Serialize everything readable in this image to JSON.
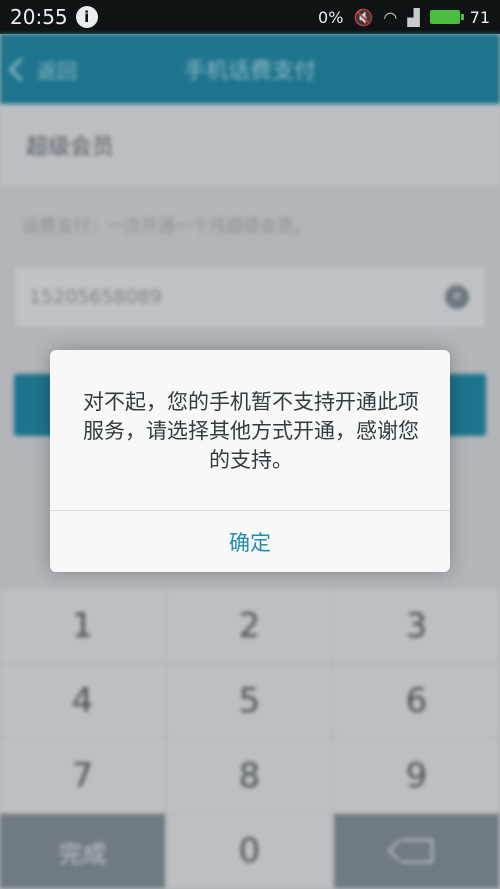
{
  "status_bar": {
    "time": "20:55",
    "network_speed": "0%",
    "battery": "71"
  },
  "header": {
    "back_label": "返回",
    "title": "手机话费支付"
  },
  "section": {
    "title": "超级会员"
  },
  "hint": "话费支付：一次开通一个月超级会员。",
  "phone_input": {
    "value": "15205658089"
  },
  "keypad": {
    "keys": [
      "1",
      "2",
      "3",
      "4",
      "5",
      "6",
      "7",
      "8",
      "9"
    ],
    "done_label": "完成",
    "zero_label": "0"
  },
  "dialog": {
    "message": "对不起，您的手机暂不支持开通此项服务，请选择其他方式开通，感谢您的支持。",
    "ok_label": "确定"
  }
}
